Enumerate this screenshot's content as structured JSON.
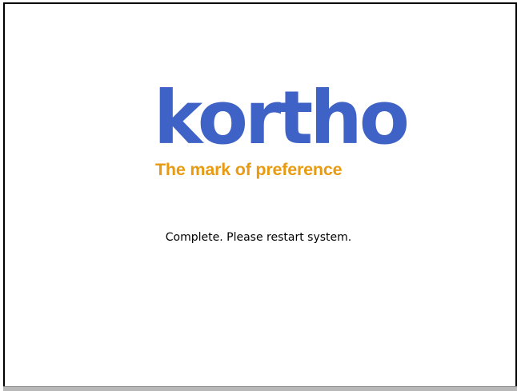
{
  "logo": {
    "wordmark": "kortho",
    "tagline": "The mark of preference"
  },
  "status": {
    "message": "Complete. Please restart system."
  },
  "colors": {
    "brand_blue": "#3f62c6",
    "brand_orange": "#e89a10",
    "background": "#ffffff",
    "frame": "#000000"
  }
}
